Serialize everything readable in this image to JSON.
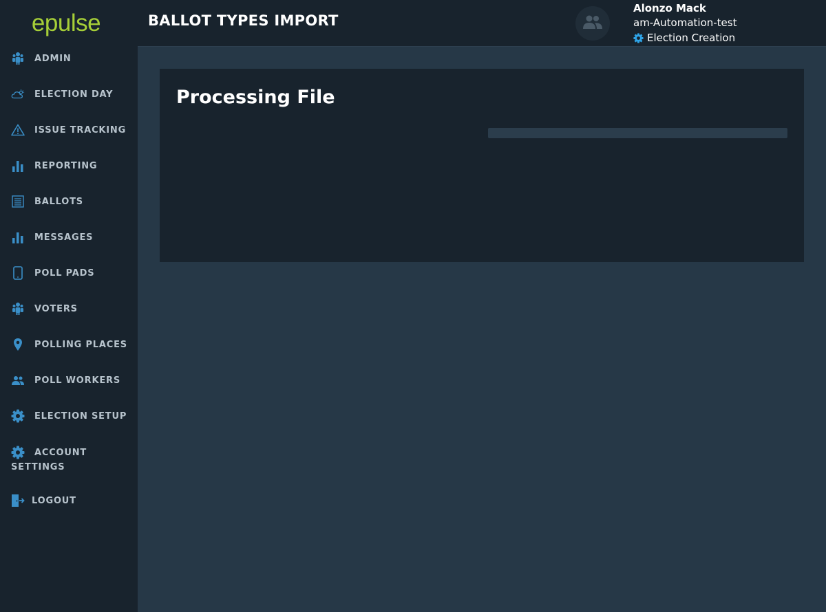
{
  "brand": {
    "logo_text": "epulse",
    "logo_color": "#a6cf38"
  },
  "sidebar": {
    "items": [
      {
        "label": "ADMIN",
        "icon": "admin-people-icon"
      },
      {
        "label": "ELECTION DAY",
        "icon": "weather-cloud-icon"
      },
      {
        "label": "ISSUE TRACKING",
        "icon": "warning-icon"
      },
      {
        "label": "REPORTING",
        "icon": "bar-chart-icon"
      },
      {
        "label": "BALLOTS",
        "icon": "ballot-list-icon"
      },
      {
        "label": "MESSAGES",
        "icon": "bar-chart-icon"
      },
      {
        "label": "POLL PADS",
        "icon": "tablet-icon"
      },
      {
        "label": "VOTERS",
        "icon": "admin-people-icon"
      },
      {
        "label": "POLLING PLACES",
        "icon": "map-pin-icon"
      },
      {
        "label": "POLL WORKERS",
        "icon": "users-icon"
      },
      {
        "label": "ELECTION SETUP",
        "icon": "gear-icon"
      },
      {
        "label_line1": "ACCOUNT",
        "label_line2": "SETTINGS",
        "icon": "gear-icon"
      },
      {
        "label": "LOGOUT",
        "icon": "logout-door-icon"
      }
    ]
  },
  "header": {
    "title": "BALLOT TYPES IMPORT",
    "user": {
      "name": "Alonzo Mack",
      "organization": "am-Automation-test",
      "role": "Election Creation",
      "role_icon": "gear-icon",
      "avatar_icon": "users-icon"
    }
  },
  "main": {
    "card_title": "Processing File",
    "progress": {
      "value_percent": 0
    }
  },
  "colors": {
    "sidebar_bg": "#18232d",
    "content_bg": "#263847",
    "icon_blue": "#3a8fc8",
    "role_gear": "#2fa4e7",
    "nav_text": "#b7c3cc"
  }
}
